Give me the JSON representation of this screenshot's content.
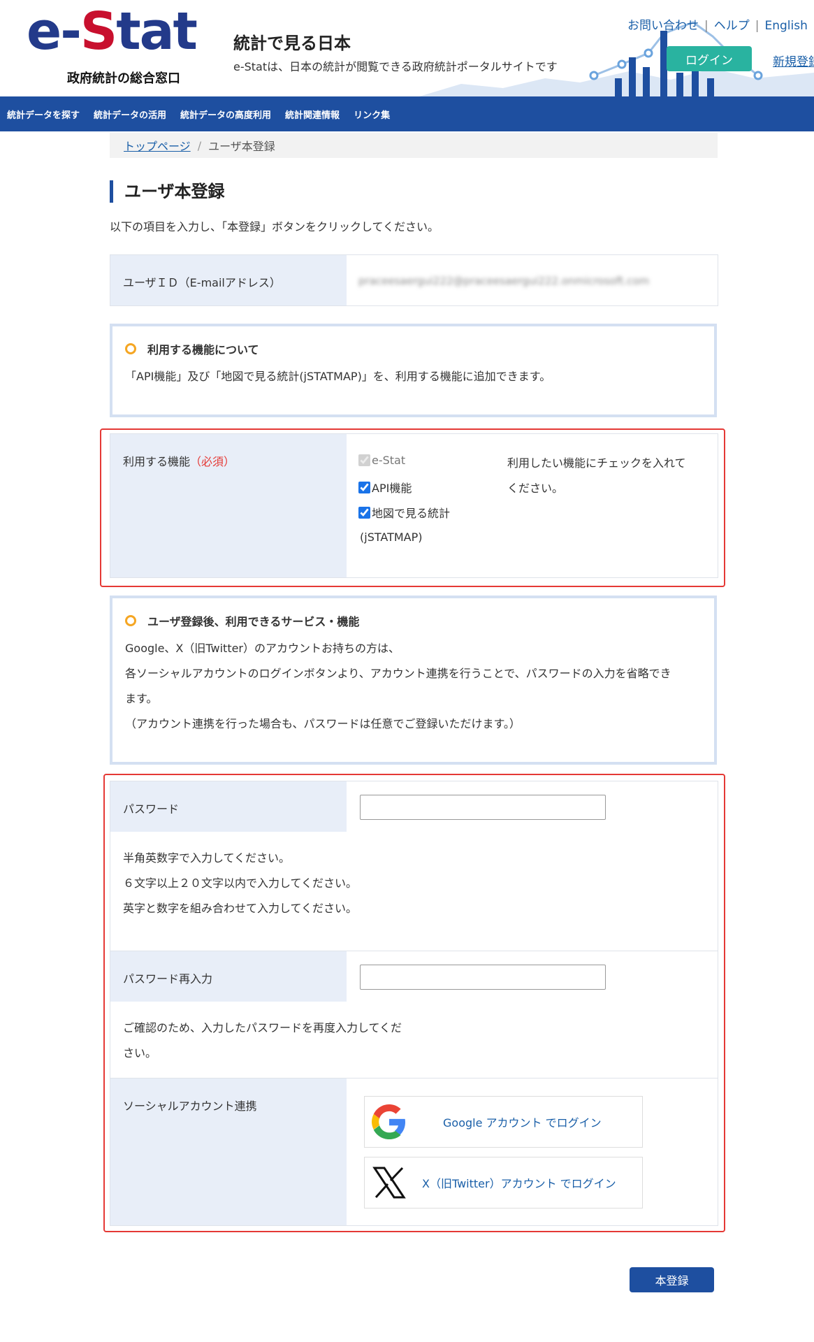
{
  "header": {
    "logo_e": "e-",
    "logo_S": "S",
    "logo_tat": "tat",
    "logo_sub": "政府統計の総合窓口",
    "site_title": "統計で見る日本",
    "site_desc": "e-Statは、日本の統計が閲覧できる政府統計ポータルサイトです",
    "links": [
      "お問い合わせ",
      "ヘルプ",
      "English"
    ],
    "login": "ログイン",
    "register": "新規登録"
  },
  "nav": [
    "統計データを探す",
    "統計データの活用",
    "統計データの高度利用",
    "統計関連情報",
    "リンク集"
  ],
  "breadcrumb": {
    "home": "トップページ",
    "sep": "/",
    "current": "ユーザ本登録"
  },
  "page": {
    "title": "ユーザ本登録",
    "intro": "以下の項目を入力し、「本登録」ボタンをクリックしてください。"
  },
  "userid": {
    "label": "ユーザＩＤ（E-mailアドレス）",
    "value": "praceesaergui222@praceesaergui222.onmicrosoft.com"
  },
  "info1": {
    "title": "利用する機能について",
    "text": "「API機能」及び「地図で見る統計(jSTATMAP)」を、利用する機能に追加できます。"
  },
  "features": {
    "label": "利用する機能",
    "required": "（必須）",
    "options": [
      {
        "label": "e-Stat",
        "checked": true,
        "disabled": true
      },
      {
        "label": "API機能",
        "checked": true,
        "disabled": false
      },
      {
        "label": "地図で見る統計",
        "checked": true,
        "disabled": false
      }
    ],
    "option3_line2": "(jSTATMAP)",
    "hint_line1": "利用したい機能にチェックを入れて",
    "hint_line2": "ください。"
  },
  "info2": {
    "title": "ユーザ登録後、利用できるサービス・機能",
    "lines": [
      "Google、X（旧Twitter）のアカウントお持ちの方は、",
      "各ソーシャルアカウントのログインボタンより、アカウント連携を行うことで、パスワードの入力を省略でき",
      "ます。",
      "（アカウント連携を行った場合も、パスワードは任意でご登録いただけます。）"
    ]
  },
  "password": {
    "label": "パスワード",
    "value": "",
    "help": [
      "半角英数字で入力してください。",
      "６文字以上２０文字以内で入力してください。",
      "英字と数字を組み合わせて入力してください。"
    ]
  },
  "password_confirm": {
    "label": "パスワード再入力",
    "value": "",
    "help": [
      "ご確認のため、入力したパスワードを再度入力してくだ",
      "さい。"
    ]
  },
  "social": {
    "label": "ソーシャルアカウント連携",
    "google": "Google アカウント でログイン",
    "x": "X（旧Twitter）アカウント でログイン"
  },
  "submit": "本登録"
}
